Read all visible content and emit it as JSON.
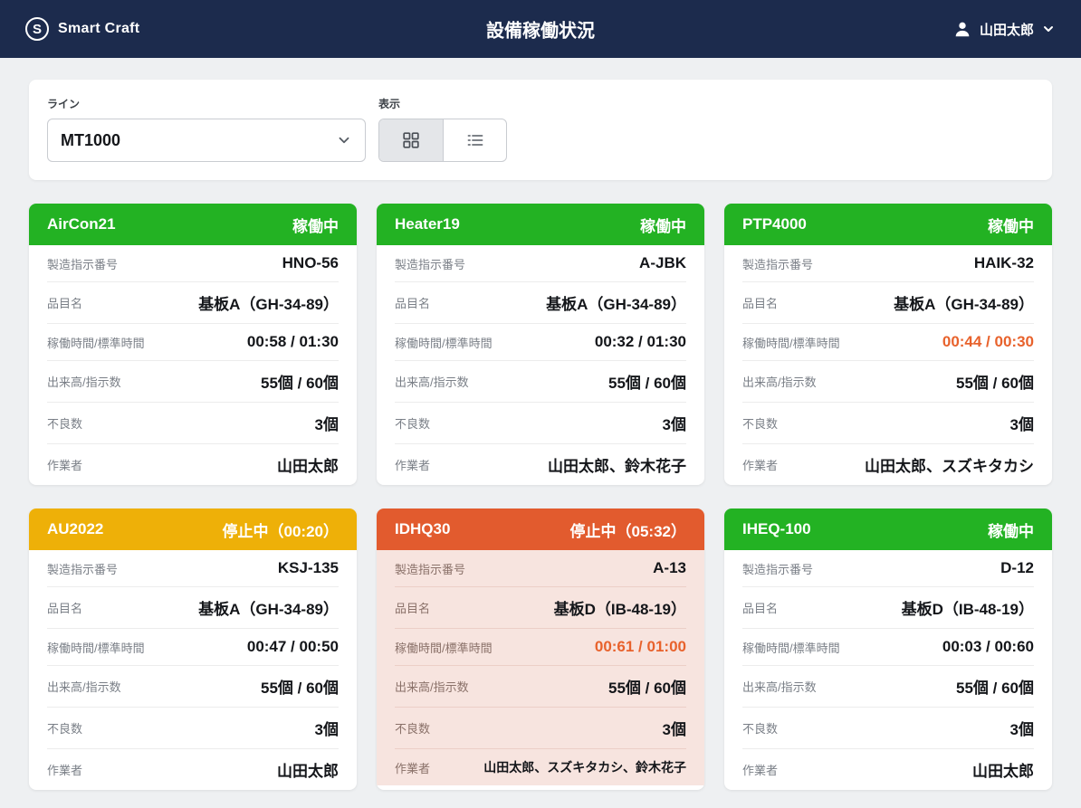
{
  "header": {
    "brand": "Smart Craft",
    "title": "設備稼働状況",
    "user_name": "山田太郎"
  },
  "filters": {
    "line_label": "ライン",
    "line_value": "MT1000",
    "view_label": "表示",
    "view_selected": "grid"
  },
  "field_labels": {
    "order_no": "製造指示番号",
    "item_name": "品目名",
    "time": "稼働時間/標準時間",
    "output": "出来高/指示数",
    "defects": "不良数",
    "workers": "作業者"
  },
  "cards": [
    {
      "name": "AirCon21",
      "status": "稼働中",
      "status_type": "running",
      "order_no": "HNO-56",
      "item_name": "基板A（GH-34-89）",
      "time": "00:58 / 01:30",
      "time_over": false,
      "output": "55個 / 60個",
      "defects": "3個",
      "workers": "山田太郎"
    },
    {
      "name": "Heater19",
      "status": "稼働中",
      "status_type": "running",
      "order_no": "A-JBK",
      "item_name": "基板A（GH-34-89）",
      "time": "00:32 / 01:30",
      "time_over": false,
      "output": "55個 / 60個",
      "defects": "3個",
      "workers": "山田太郎、鈴木花子"
    },
    {
      "name": "PTP4000",
      "status": "稼働中",
      "status_type": "running",
      "order_no": "HAIK-32",
      "item_name": "基板A（GH-34-89）",
      "time": "00:44 / 00:30",
      "time_over": true,
      "output": "55個 / 60個",
      "defects": "3個",
      "workers": "山田太郎、スズキタカシ"
    },
    {
      "name": "AU2022",
      "status": "停止中（00:20）",
      "status_type": "paused",
      "order_no": "KSJ-135",
      "item_name": "基板A（GH-34-89）",
      "time": "00:47 / 00:50",
      "time_over": false,
      "output": "55個 / 60個",
      "defects": "3個",
      "workers": "山田太郎"
    },
    {
      "name": "IDHQ30",
      "status": "停止中（05:32）",
      "status_type": "stopped",
      "order_no": "A-13",
      "item_name": "基板D（IB-48-19）",
      "time": "00:61 / 01:00",
      "time_over": true,
      "output": "55個 / 60個",
      "defects": "3個",
      "workers": "山田太郎、スズキタカシ、鈴木花子"
    },
    {
      "name": "IHEQ-100",
      "status": "稼働中",
      "status_type": "running",
      "order_no": "D-12",
      "item_name": "基板D（IB-48-19）",
      "time": "00:03 / 00:60",
      "time_over": false,
      "output": "55個 / 60個",
      "defects": "3個",
      "workers": "山田太郎"
    }
  ],
  "colors": {
    "header_bg": "#1c2b4d",
    "status_running": "#23b223",
    "status_paused": "#eeb008",
    "status_stopped": "#e25b2e",
    "stopped_card_bg": "#f7e4df",
    "time_over_text": "#e8622c",
    "page_bg": "#eef0f2"
  }
}
